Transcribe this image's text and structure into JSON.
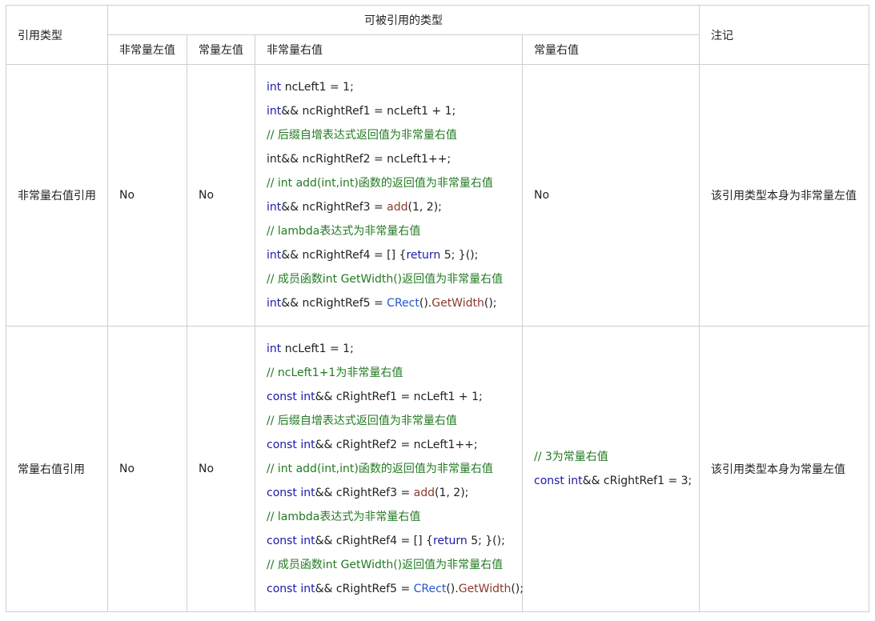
{
  "headers": {
    "ref_type": "引用类型",
    "refable": "可被引用的类型",
    "note": "注记",
    "cols": [
      "非常量左值",
      "常量左值",
      "非常量右值",
      "常量右值"
    ]
  },
  "rows": [
    {
      "name": "非常量右值引用",
      "nc_lvalue": "No",
      "c_lvalue": "No",
      "nc_rvalue_lines": [
        [
          {
            "t": "kw",
            "v": "int"
          },
          {
            "t": "ident",
            "v": " ncLeft1 = 1;"
          }
        ],
        [
          {
            "t": "kw",
            "v": "int"
          },
          {
            "t": "ident",
            "v": "&& ncRightRef1 = ncLeft1 + 1;"
          }
        ],
        [
          {
            "t": "cm",
            "v": " // 后缀自增表达式返回值为非常量右值"
          }
        ],
        [
          {
            "t": "ident",
            "v": "int&& ncRightRef2 = ncLeft1++;"
          }
        ],
        [
          {
            "t": "cm",
            "v": "// int add(int,int)函数的返回值为非常量右值"
          }
        ],
        [
          {
            "t": "kw",
            "v": "int"
          },
          {
            "t": "ident",
            "v": "&& ncRightRef3 = "
          },
          {
            "t": "fn",
            "v": "add"
          },
          {
            "t": "ident",
            "v": "(1, 2);"
          }
        ],
        [
          {
            "t": "cm",
            "v": "// lambda表达式为非常量右值"
          }
        ],
        [
          {
            "t": "kw",
            "v": "int"
          },
          {
            "t": "ident",
            "v": "&& ncRightRef4 = [] {"
          },
          {
            "t": "kw",
            "v": "return"
          },
          {
            "t": "ident",
            "v": " 5; }();"
          }
        ],
        [
          {
            "t": "cm",
            "v": "// 成员函数int GetWidth()返回值为非常量右值"
          }
        ],
        [
          {
            "t": "kw",
            "v": "int"
          },
          {
            "t": "ident",
            "v": "&& ncRightRef5 = "
          },
          {
            "t": "cls",
            "v": "CRect"
          },
          {
            "t": "ident",
            "v": "()."
          },
          {
            "t": "fn",
            "v": "GetWidth"
          },
          {
            "t": "ident",
            "v": "();"
          }
        ]
      ],
      "c_rvalue_lines": [
        [
          {
            "t": "ident",
            "v": "No"
          }
        ]
      ],
      "note": "该引用类型本身为非常量左值"
    },
    {
      "name": "常量右值引用",
      "nc_lvalue": "No",
      "c_lvalue": "No",
      "nc_rvalue_lines": [
        [
          {
            "t": "kw",
            "v": "int"
          },
          {
            "t": "ident",
            "v": " ncLeft1 = 1;"
          }
        ],
        [
          {
            "t": "cm",
            "v": "// ncLeft1+1为非常量右值"
          }
        ],
        [
          {
            "t": "kw",
            "v": "const int"
          },
          {
            "t": "ident",
            "v": "&& cRightRef1 = ncLeft1 + 1;"
          }
        ],
        [
          {
            "t": "cm",
            "v": "// 后缀自增表达式返回值为非常量右值"
          }
        ],
        [
          {
            "t": "kw",
            "v": "const int"
          },
          {
            "t": "ident",
            "v": "&& cRightRef2 = ncLeft1++;"
          }
        ],
        [
          {
            "t": "cm",
            "v": "// int add(int,int)函数的返回值为非常量右值"
          }
        ],
        [
          {
            "t": "kw",
            "v": "const int"
          },
          {
            "t": "ident",
            "v": "&& cRightRef3 = "
          },
          {
            "t": "fn",
            "v": "add"
          },
          {
            "t": "ident",
            "v": "(1, 2);"
          }
        ],
        [
          {
            "t": "cm",
            "v": "// lambda表达式为非常量右值"
          }
        ],
        [
          {
            "t": "kw",
            "v": "const int"
          },
          {
            "t": "ident",
            "v": "&& cRightRef4 = [] {"
          },
          {
            "t": "kw",
            "v": "return"
          },
          {
            "t": "ident",
            "v": " 5; }();"
          }
        ],
        [
          {
            "t": "cm",
            "v": "// 成员函数int GetWidth()返回值为非常量右值"
          }
        ],
        [
          {
            "t": "kw",
            "v": "const int"
          },
          {
            "t": "ident",
            "v": "&& cRightRef5 = "
          },
          {
            "t": "cls",
            "v": "CRect"
          },
          {
            "t": "ident",
            "v": "()."
          },
          {
            "t": "fn",
            "v": "GetWidth"
          },
          {
            "t": "ident",
            "v": "();"
          }
        ]
      ],
      "c_rvalue_lines": [
        [
          {
            "t": "cm",
            "v": "// 3为常量右值"
          }
        ],
        [
          {
            "t": "kw",
            "v": "const int"
          },
          {
            "t": "ident",
            "v": "&& cRightRef1 = 3;"
          }
        ]
      ],
      "note": "该引用类型本身为常量左值"
    }
  ]
}
